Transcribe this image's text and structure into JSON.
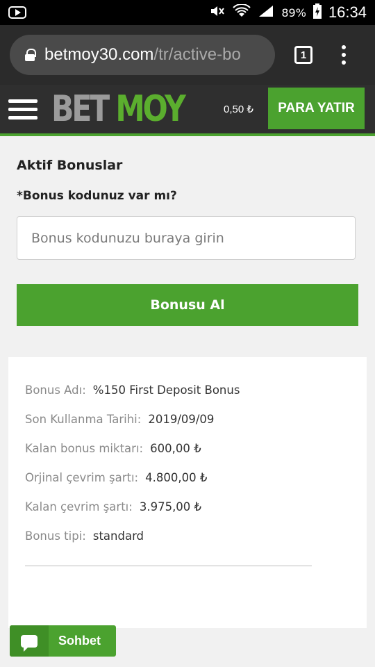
{
  "status_bar": {
    "battery_percent": "89%",
    "time": "16:34",
    "icons": [
      "youtube-icon",
      "mute-icon",
      "wifi-icon",
      "signal-icon",
      "battery-charging-icon"
    ]
  },
  "browser": {
    "url_host": "betmoy30.com",
    "url_path": "/tr/active-bo",
    "tab_count": "1"
  },
  "site_header": {
    "logo_part1": "BET",
    "logo_part2": "MOY",
    "balance": "0,50 ₺",
    "deposit_label": "PARA YATIR"
  },
  "main": {
    "title": "Aktif Bonuslar",
    "bonus_question": "*Bonus kodunuz var mı?",
    "bonus_input_placeholder": "Bonus kodunuzu buraya girin",
    "bonus_input_value": "",
    "claim_label": "Bonusu Al"
  },
  "bonus_details": {
    "rows": [
      {
        "label": "Bonus Adı:",
        "value": "%150 First Deposit Bonus"
      },
      {
        "label": "Son Kullanma Tarihi:",
        "value": "2019/09/09"
      },
      {
        "label": "Kalan bonus miktarı:",
        "value": "600,00 ₺"
      },
      {
        "label": "Orjinal çevrim şartı:",
        "value": "4.800,00 ₺"
      },
      {
        "label": "Kalan çevrim şartı:",
        "value": "3.975,00 ₺"
      },
      {
        "label": "Bonus tipi:",
        "value": "standard"
      }
    ]
  },
  "chat": {
    "label": "Sohbet"
  },
  "colors": {
    "accent_green": "#4ba22f",
    "header_bg": "#2f2f2f",
    "browser_bg": "#2b2b2b"
  }
}
